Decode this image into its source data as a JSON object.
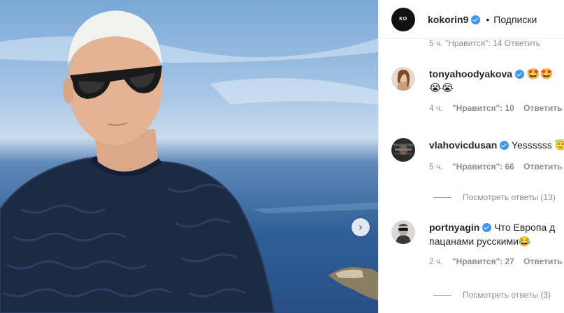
{
  "post": {
    "author": "kokorin9",
    "author_avatar_text": "KO",
    "separator": "•",
    "follow_label": "Подписки"
  },
  "cut_comment_meta": "5 ч.   \"Нравится\": 14   Ответить",
  "comments": [
    {
      "username": "tonyahoodyakova",
      "verified": true,
      "text": "🤩🤩",
      "text_line2": "😭😭",
      "time": "4 ч.",
      "likes": "\"Нравится\": 10",
      "reply": "Ответить"
    },
    {
      "username": "vlahovicdusan",
      "verified": true,
      "text": "Yessssss 😇",
      "time": "5 ч.",
      "likes": "\"Нравится\": 66",
      "reply": "Ответить",
      "view_replies": "Посмотреть ответы (13)"
    },
    {
      "username": "portnyagin",
      "verified": true,
      "text": "Что Европа д",
      "text_line2": "пацанами русскими😂",
      "time": "2 ч.",
      "likes": "\"Нравится\": 27",
      "reply": "Ответить",
      "view_replies": "Посмотреть ответы (3)"
    }
  ],
  "colors": {
    "text": "#262626",
    "muted": "#8e8e8e",
    "verified": "#3897f0",
    "divider": "#efefef"
  },
  "icons": {
    "verified": "verified-badge-icon",
    "next": "chevron-right-icon"
  }
}
